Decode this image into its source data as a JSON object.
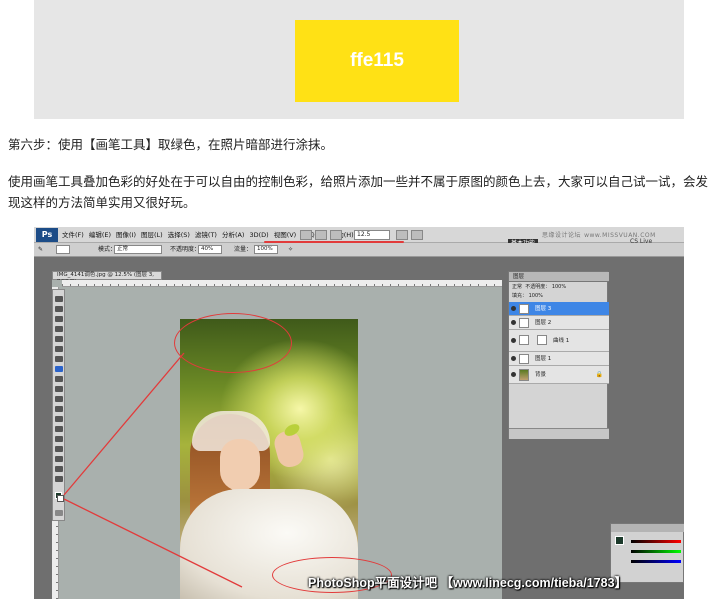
{
  "color_block": {
    "label": "ffe115",
    "hex": "#ffe115"
  },
  "step_text": "第六步：使用【画笔工具】取绿色，在照片暗部进行涂抹。",
  "body_text": "使用画笔工具叠加色彩的好处在于可以自由的控制色彩，给照片添加一些并不属于原图的颜色上去，大家可以自己试一试，会发现这样的方法简单实用又很好玩。",
  "photoshop": {
    "logo": "Ps",
    "menu": [
      "文件(F)",
      "编辑(E)",
      "图像(I)",
      "图层(L)",
      "选择(S)",
      "滤镜(T)",
      "分析(A)",
      "3D(D)",
      "视图(V)",
      "窗口(W)",
      "帮助(H)"
    ],
    "zoom": "12.5",
    "workspace": "基本功能",
    "cs_live": "CS Live",
    "watermark_top": "思缘设计论坛",
    "watermark_top_url": "www.MISSVUAN.COM",
    "options": {
      "mode_label": "模式：",
      "mode_value": "正常",
      "opacity_label": "不透明度：",
      "opacity_value": "40%",
      "flow_label": "流量：",
      "flow_value": "100%"
    },
    "doc_tab": "IMG_4141调色.jpg @ 12.5% (图层 3, RGB/8)",
    "layers": {
      "header": "图层",
      "blend": "正常",
      "opacity_label": "不透明度：",
      "opacity_value": "100%",
      "fill_label": "填充：",
      "fill_value": "100%",
      "rows": [
        {
          "name": "图层 3",
          "selected": true
        },
        {
          "name": "图层 2",
          "selected": false
        },
        {
          "name": "曲线 1",
          "selected": false
        },
        {
          "name": "图层 1",
          "selected": false
        },
        {
          "name": "背景",
          "selected": false
        }
      ]
    },
    "colors": {
      "foreground": "#1c3a2b",
      "background": "#ffffff",
      "accent_red": "#e23b3b",
      "selection_blue": "#3e86e6"
    }
  },
  "watermark_bottom": "PhotoShop平面设计吧 【www.linecg.com/tieba/1783】"
}
